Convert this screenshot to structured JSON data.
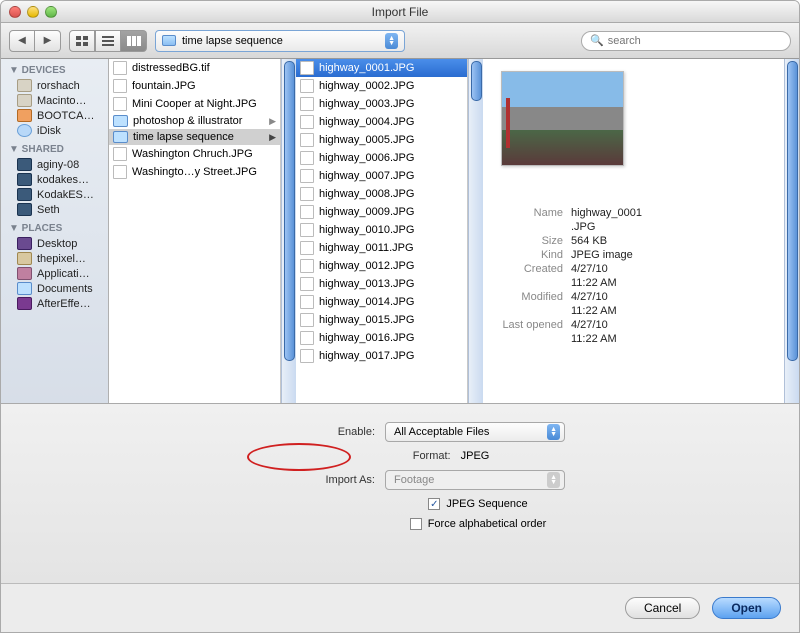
{
  "window": {
    "title": "Import File"
  },
  "toolbar": {
    "breadcrumb": "time lapse sequence",
    "search_placeholder": "search"
  },
  "sidebar": {
    "sections": [
      {
        "header": "▼ DEVICES",
        "items": [
          {
            "label": "rorshach",
            "icon": "ic-drive"
          },
          {
            "label": "Macinto…",
            "icon": "ic-drive"
          },
          {
            "label": "BOOTCA…",
            "icon": "ic-ext"
          },
          {
            "label": "iDisk",
            "icon": "ic-idisk"
          }
        ]
      },
      {
        "header": "▼ SHARED",
        "items": [
          {
            "label": "aginy-08",
            "icon": "ic-monitor"
          },
          {
            "label": "kodakes…",
            "icon": "ic-monitor"
          },
          {
            "label": "KodakES…",
            "icon": "ic-monitor"
          },
          {
            "label": "Seth",
            "icon": "ic-monitor"
          }
        ]
      },
      {
        "header": "▼ PLACES",
        "items": [
          {
            "label": "Desktop",
            "icon": "ic-desktop"
          },
          {
            "label": "thepixel…",
            "icon": "ic-home"
          },
          {
            "label": "Applicati…",
            "icon": "ic-app"
          },
          {
            "label": "Documents",
            "icon": "ic-folder"
          },
          {
            "label": "AfterEffe…",
            "icon": "ic-ae"
          }
        ]
      }
    ]
  },
  "column1": [
    {
      "name": "distressedBG.tif",
      "type": "file"
    },
    {
      "name": "fountain.JPG",
      "type": "file"
    },
    {
      "name": "Mini Cooper at Night.JPG",
      "type": "file"
    },
    {
      "name": "photoshop & illustrator",
      "type": "folder",
      "hasArrow": true
    },
    {
      "name": "time lapse sequence",
      "type": "folder",
      "hasArrow": true,
      "selected": true
    },
    {
      "name": "Washington Chruch.JPG",
      "type": "file"
    },
    {
      "name": "Washingto…y Street.JPG",
      "type": "file"
    }
  ],
  "column2": [
    {
      "name": "highway_0001.JPG",
      "highlighted": true
    },
    {
      "name": "highway_0002.JPG"
    },
    {
      "name": "highway_0003.JPG"
    },
    {
      "name": "highway_0004.JPG"
    },
    {
      "name": "highway_0005.JPG"
    },
    {
      "name": "highway_0006.JPG"
    },
    {
      "name": "highway_0007.JPG"
    },
    {
      "name": "highway_0008.JPG"
    },
    {
      "name": "highway_0009.JPG"
    },
    {
      "name": "highway_0010.JPG"
    },
    {
      "name": "highway_0011.JPG"
    },
    {
      "name": "highway_0012.JPG"
    },
    {
      "name": "highway_0013.JPG"
    },
    {
      "name": "highway_0014.JPG"
    },
    {
      "name": "highway_0015.JPG"
    },
    {
      "name": "highway_0016.JPG"
    },
    {
      "name": "highway_0017.JPG"
    }
  ],
  "preview": {
    "name": {
      "k": "Name",
      "v": "highway_0001"
    },
    "ext": {
      "k": "",
      "v": ".JPG"
    },
    "size": {
      "k": "Size",
      "v": "564 KB"
    },
    "kind": {
      "k": "Kind",
      "v": "JPEG image"
    },
    "created": {
      "k": "Created",
      "v": "4/27/10"
    },
    "created2": {
      "k": "",
      "v": "11:22 AM"
    },
    "modified": {
      "k": "Modified",
      "v": "4/27/10"
    },
    "modified2": {
      "k": "",
      "v": "11:22 AM"
    },
    "opened": {
      "k": "Last opened",
      "v": "4/27/10"
    },
    "opened2": {
      "k": "",
      "v": "11:22 AM"
    }
  },
  "options": {
    "enable_label": "Enable:",
    "enable_value": "All Acceptable Files",
    "format_label": "Format:",
    "format_value": "JPEG",
    "import_label": "Import As:",
    "import_value": "Footage",
    "jpeg_sequence": "JPEG Sequence",
    "jpeg_sequence_checked": true,
    "force_alpha": "Force alphabetical order",
    "force_alpha_checked": false
  },
  "buttons": {
    "cancel": "Cancel",
    "open": "Open"
  }
}
